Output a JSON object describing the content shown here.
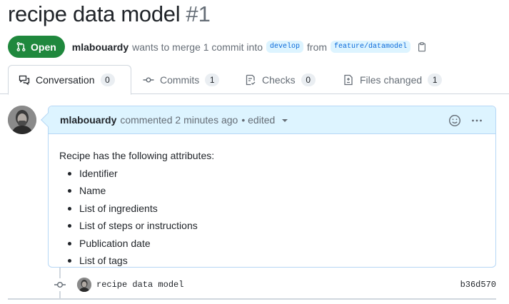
{
  "pr": {
    "title": "recipe data model",
    "number": "#1",
    "state": "Open",
    "author": "mlabouardy",
    "merge_text": "wants to merge 1 commit into",
    "base_branch": "develop",
    "from_text": "from",
    "head_branch": "feature/datamodel"
  },
  "tabs": [
    {
      "label": "Conversation",
      "count": "0",
      "icon": "comment-discussion-icon"
    },
    {
      "label": "Commits",
      "count": "1",
      "icon": "git-commit-icon"
    },
    {
      "label": "Checks",
      "count": "0",
      "icon": "checklist-icon"
    },
    {
      "label": "Files changed",
      "count": "1",
      "icon": "file-diff-icon"
    }
  ],
  "comment": {
    "author": "mlabouardy",
    "time": "commented 2 minutes ago",
    "edited": "• edited",
    "intro": "Recipe has the following attributes:",
    "items": [
      "Identifier",
      "Name",
      "List of ingredients",
      "List of steps or instructions",
      "Publication date",
      "List of tags"
    ]
  },
  "commit": {
    "message": "recipe data model",
    "sha": "b36d570"
  },
  "colors": {
    "open_green": "#1f883d",
    "header_blue": "#ddf4ff",
    "branch_blue": "#0969da"
  }
}
